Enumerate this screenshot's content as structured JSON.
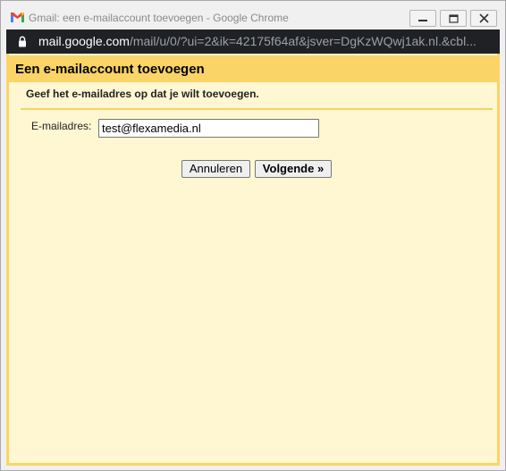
{
  "window": {
    "title": "Gmail: een e-mailaccount toevoegen - Google Chrome"
  },
  "address_bar": {
    "host": "mail.google.com",
    "path": "/mail/u/0/?ui=2&ik=42175f64af&jsver=DgKzWQwj1ak.nl.&cbl..."
  },
  "dialog": {
    "title": "Een e-mailaccount toevoegen",
    "instruction": "Geef het e-mailadres op dat je wilt toevoegen.",
    "email_label": "E-mailadres:",
    "email_value": "test@flexamedia.nl",
    "cancel_label": "Annuleren",
    "next_label": "Volgende »"
  },
  "colors": {
    "header": "#fbd467",
    "dialog_bg": "#fff7d2",
    "addressbar_bg": "#202124"
  },
  "icons": {
    "app": "gmail-logo-icon",
    "secure": "lock-icon",
    "minimize": "minimize-icon",
    "maximize": "maximize-icon",
    "close": "close-icon"
  }
}
